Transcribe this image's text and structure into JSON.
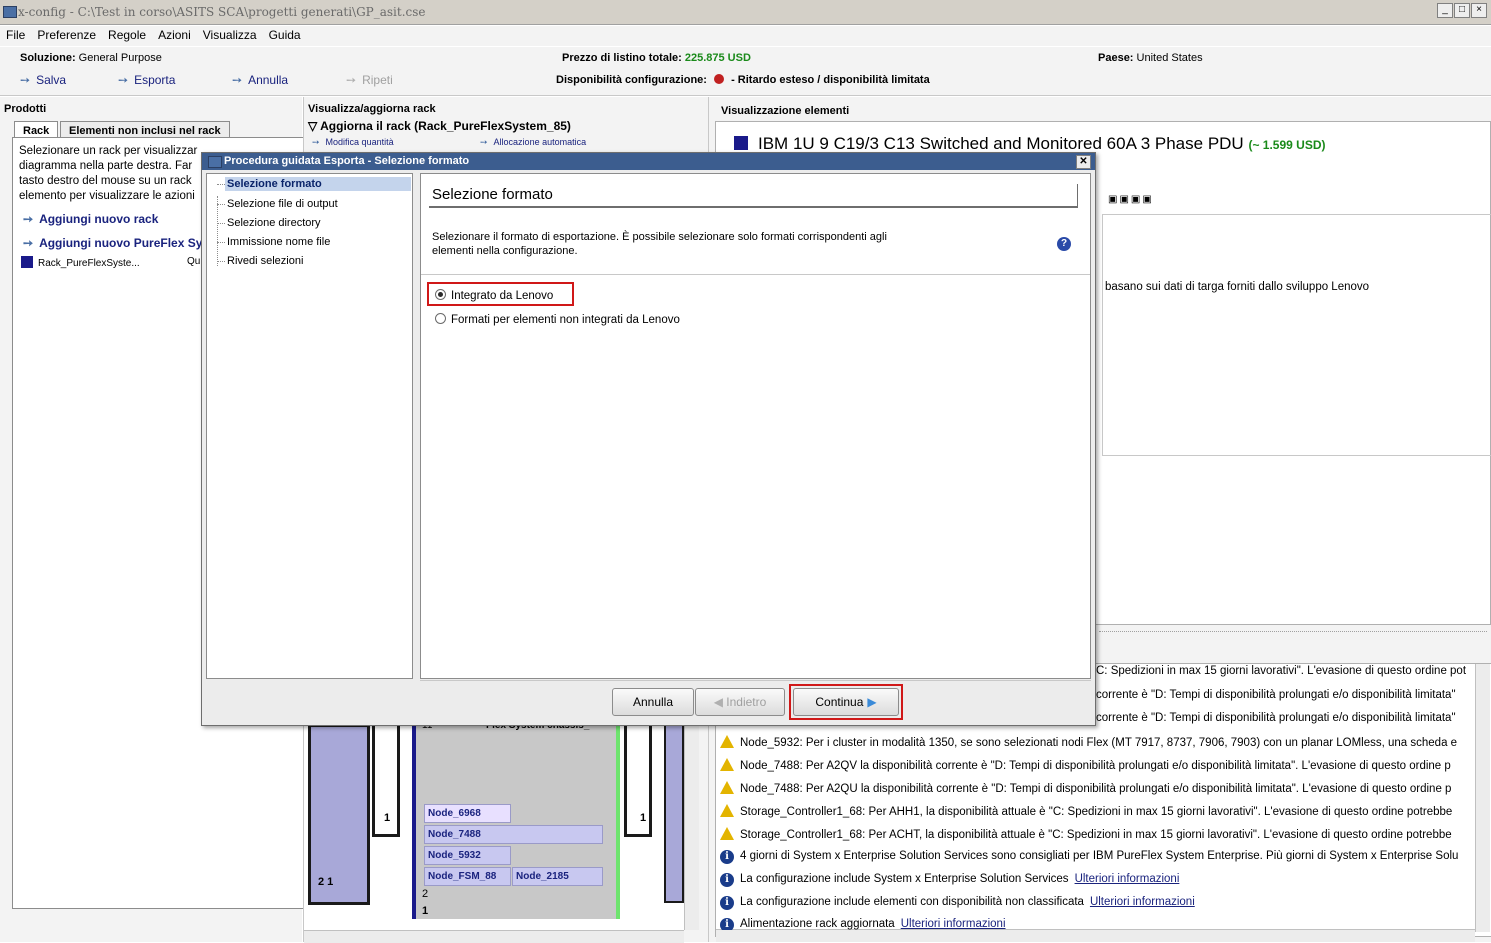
{
  "window": {
    "title": "x-config - C:\\Test in corso\\ASITS SCA\\progetti generati\\GP_asit.cse"
  },
  "menu": [
    "File",
    "Preferenze",
    "Regole",
    "Azioni",
    "Visualizza",
    "Guida"
  ],
  "info": {
    "soluzione_label": "Soluzione:",
    "soluzione_value": "General Purpose",
    "prezzo_label": "Prezzo di listino totale:",
    "prezzo_value": "225.875 USD",
    "paese_label": "Paese:",
    "paese_value": "United States",
    "disp_label": "Disponibilità configurazione:",
    "disp_value": "- Ritardo esteso / disponibilità limitata"
  },
  "actions": {
    "salva": "Salva",
    "esporta": "Esporta",
    "annulla": "Annulla",
    "ripeti": "Ripeti"
  },
  "prodotti": {
    "title": "Prodotti",
    "tab_rack": "Rack",
    "tab_non_inclusi": "Elementi non inclusi nel rack",
    "desc": [
      "Selezionare un rack per visualizzar",
      "diagramma nella parte destra. Far",
      "tasto destro del mouse su un rack",
      "elemento per visualizzare le azioni"
    ],
    "add_rack": "Aggiungi nuovo rack",
    "add_pureflex": "Aggiungi nuovo PureFlex Syst",
    "rack_item": "Rack_PureFlexSyste...",
    "rack_item_extra": "Qu"
  },
  "rack_panel": {
    "title": "Visualizza/aggiorna rack",
    "aggiorna": "Aggiorna il rack (Rack_PureFlexSystem_85)",
    "modifica": "Modifica quantità",
    "allocazione": "Allocazione automatica",
    "chassis": "Flex System chassis_",
    "chassis_num": "11",
    "rack_nums": {
      "left": "1",
      "right": "1",
      "bottom_left": "2 1",
      "bottom_mid": "2",
      "bottom_mid2": "1"
    },
    "nodes": [
      "Node_6968",
      "Node_7488",
      "Node_5932",
      "Node_FSM_88",
      "Node_2185"
    ]
  },
  "elementi": {
    "title": "Visualizzazione elementi",
    "product": "IBM 1U 9 C19/3 C13 Switched and Monitored 60A 3 Phase PDU",
    "price": "(~ 1.599 USD)",
    "partial_text": "basano sui dati di targa forniti dallo sviluppo Lenovo"
  },
  "dialog": {
    "title": "Procedura guidata Esporta - Selezione formato",
    "steps": [
      "Selezione formato",
      "Selezione file di output",
      "Selezione directory",
      "Immissione nome file",
      "Rivedi selezioni"
    ],
    "header": "Selezione formato",
    "description_line1": "Selezionare il formato di esportazione. È possibile selezionare solo formati corrispondenti agli",
    "description_line2": "elementi nella configurazione.",
    "options": [
      "Integrato da Lenovo",
      "Formati per elementi non integrati da Lenovo"
    ],
    "buttons": {
      "annulla": "Annulla",
      "indietro": "Indietro",
      "continua": "Continua"
    }
  },
  "messages": [
    {
      "icon": "warning",
      "text": "C: Spedizioni in max 15 giorni lavorativi\". L'evasione di questo ordine pot"
    },
    {
      "icon": "warning",
      "text": "corrente è \"D: Tempi di disponibilità prolungati e/o disponibilità limitata\""
    },
    {
      "icon": "warning",
      "text": "corrente è \"D: Tempi di disponibilità prolungati e/o disponibilità limitata\""
    },
    {
      "icon": "warning",
      "text": "Node_5932: Per i cluster in modalità 1350, se sono selezionati nodi Flex (MT 7917, 8737, 7906, 7903) con un planar LOMless, una scheda e"
    },
    {
      "icon": "warning",
      "text": "Node_7488: Per A2QV la disponibilità corrente è \"D: Tempi di disponibilità prolungati e/o disponibilità limitata\". L'evasione di questo ordine p"
    },
    {
      "icon": "warning",
      "text": "Node_7488: Per A2QU la disponibilità corrente è \"D: Tempi di disponibilità prolungati e/o disponibilità limitata\". L'evasione di questo ordine p"
    },
    {
      "icon": "warning",
      "text": "Storage_Controller1_68: Per AHH1, la disponibilità attuale è \"C: Spedizioni in max 15 giorni lavorativi\". L'evasione di questo ordine potrebbe"
    },
    {
      "icon": "warning",
      "text": "Storage_Controller1_68: Per ACHT, la disponibilità attuale è \"C: Spedizioni in max 15 giorni lavorativi\". L'evasione di questo ordine potrebbe"
    },
    {
      "icon": "info",
      "text": "4 giorni di System x Enterprise Solution Services sono consigliati per IBM PureFlex System Enterprise. Più giorni di System x Enterprise Solu"
    },
    {
      "icon": "info",
      "text": "La configurazione include System x Enterprise Solution Services",
      "link": "Ulteriori informazioni"
    },
    {
      "icon": "info",
      "text": "La configurazione include elementi con disponibilità non classificata",
      "link": "Ulteriori informazioni"
    },
    {
      "icon": "info",
      "text": "Alimentazione rack aggiornata",
      "link": "Ulteriori informazioni"
    }
  ],
  "colors": {
    "accent": "#1a237e",
    "price": "#1a8a1a",
    "highlight": "#d01818",
    "dialog_title": "#3c5d8f"
  }
}
